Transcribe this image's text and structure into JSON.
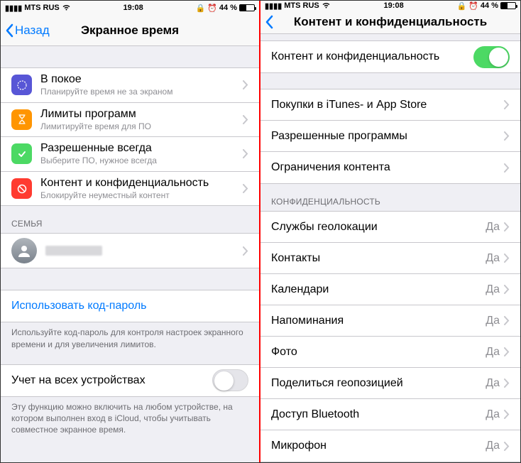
{
  "statusbar": {
    "carrier": "MTS RUS",
    "wifi_icon": "wifi",
    "time": "19:08",
    "orient_icon": "lock",
    "alarm_icon": "alarm",
    "battery_pct": "44 %"
  },
  "left": {
    "back_label": "Назад",
    "title": "Экранное время",
    "items": [
      {
        "title": "В покое",
        "sub": "Планируйте время не за экраном",
        "iconColor": "#5856d6"
      },
      {
        "title": "Лимиты программ",
        "sub": "Лимитируйте время для ПО",
        "iconColor": "#ff9500"
      },
      {
        "title": "Разрешенные всегда",
        "sub": "Выберите ПО, нужное всегда",
        "iconColor": "#4cd964"
      },
      {
        "title": "Контент и конфиденциальность",
        "sub": "Блокируйте неуместный контент",
        "iconColor": "#ff3b30"
      }
    ],
    "family_header": "СЕМЬЯ",
    "passcode_link": "Использовать код-пароль",
    "passcode_footer": "Используйте код-пароль для контроля настроек экранного времени и для увеличения лимитов.",
    "share_title": "Учет на всех устройствах",
    "share_footer": "Эту функцию можно включить на любом устройстве, на котором выполнен вход в iCloud, чтобы учитывать совместное экранное время."
  },
  "right": {
    "title": "Контент и конфиденциальность",
    "toggle_title": "Контент и конфиденциальность",
    "group1": [
      "Покупки в iTunes- и App Store",
      "Разрешенные программы",
      "Ограничения контента"
    ],
    "privacy_header": "КОНФИДЕНЦИАЛЬНОСТЬ",
    "value_yes": "Да",
    "privacy_items": [
      "Службы геолокации",
      "Контакты",
      "Календари",
      "Напоминания",
      "Фото",
      "Поделиться геопозицией",
      "Доступ Bluetooth",
      "Микрофон"
    ]
  }
}
